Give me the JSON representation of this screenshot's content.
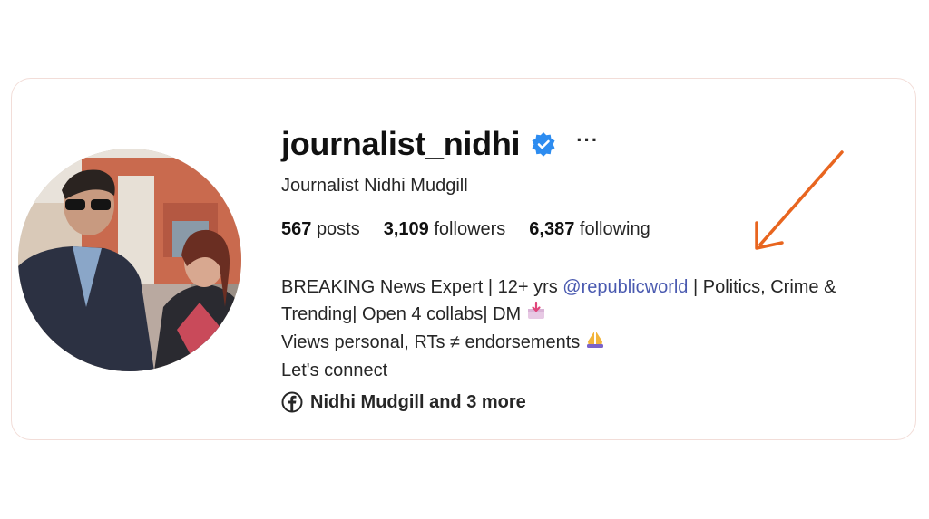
{
  "profile": {
    "username": "journalist_nidhi",
    "full_name": "Journalist Nidhi Mudgill",
    "more_label": "···",
    "stats": {
      "posts_count": "567",
      "posts_label": "posts",
      "followers_count": "3,109",
      "followers_label": "followers",
      "following_count": "6,387",
      "following_label": "following"
    },
    "bio": {
      "line1_prefix": "BREAKING News Expert | 12+ yrs ",
      "line1_mention": "@republicworld",
      "line1_suffix": " | Politics, Crime &",
      "line2": "Trending| Open 4 collabs| DM ",
      "line3": "Views personal, RTs ≠ endorsements ",
      "line4": "Let's connect"
    },
    "links_label": "Nidhi Mudgill and 3 more"
  },
  "colors": {
    "verified_badge": "#2d8cf0",
    "mention": "#4a5ab0",
    "annotation_arrow": "#e8651f",
    "card_border": "#f2ddd8"
  },
  "icons": {
    "verified": "verified-badge-icon",
    "more": "more-options-icon",
    "inbox": "inbox-tray-icon",
    "folded_hands": "folded-hands-icon",
    "facebook": "facebook-icon",
    "arrow": "annotation-arrow-icon"
  }
}
